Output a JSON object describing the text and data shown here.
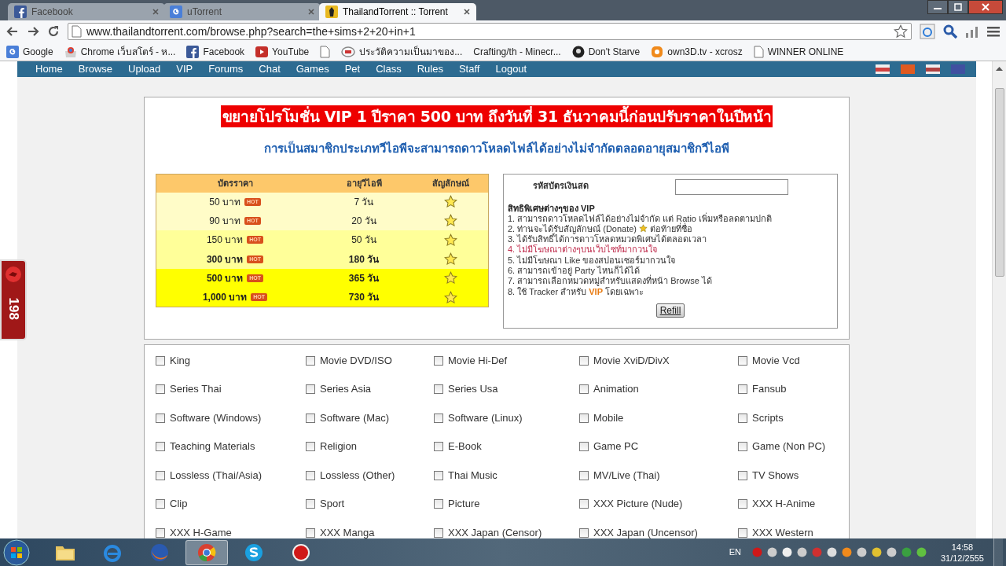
{
  "browser": {
    "tabs": [
      {
        "title": "Facebook",
        "selected": false,
        "kind": "facebook"
      },
      {
        "title": "uTorrent",
        "selected": false,
        "kind": "google"
      },
      {
        "title": "ThailandTorrent :: Torrent",
        "selected": true,
        "kind": "site"
      }
    ],
    "url": "www.thailandtorrent.com/browse.php?search=the+sims+2+20+in+1",
    "bookmarks": [
      {
        "label": "Google",
        "kind": "google"
      },
      {
        "label": "Chrome เว็บสโตร์ - ห...",
        "kind": "store"
      },
      {
        "label": "Facebook",
        "kind": "facebook"
      },
      {
        "label": "YouTube",
        "kind": "youtube"
      },
      {
        "kind": "page"
      },
      {
        "label": "ประวัติความเป็นมาของ...",
        "kind": "ring"
      },
      {
        "label": "Crafting/th - Minecr...",
        "kind": "plain"
      },
      {
        "label": "Don't Starve",
        "kind": "dark"
      },
      {
        "label": "own3D.tv - xcrosz",
        "kind": "orange"
      },
      {
        "label": "WINNER ONLINE",
        "kind": "page"
      }
    ]
  },
  "nav": [
    "Home",
    "Browse",
    "Upload",
    "VIP",
    "Forums",
    "Chat",
    "Games",
    "Pet",
    "Class",
    "Rules",
    "Staff",
    "Logout"
  ],
  "side_badge": "198",
  "promo": {
    "banner": "ขยายโปรโมชั่น VIP 1 ปีราคา 500 บาท ถึงวันที่ 31 ธันวาคมนี้ก่อนปรับราคาในปีหน้า",
    "subtitle": "การเป็นสมาชิกประเภทวีไอพีจะสามารถดาวโหลดไฟล์ได้อย่างไม่จำกัดตลอดอายุสมาชิกวีไอพี",
    "table": {
      "columns": [
        "บัตรราคา",
        "อายุวีไอพี",
        "สัญลักษณ์"
      ],
      "rows": [
        {
          "price": "50 บาท",
          "badge": "HOT",
          "days": "7 วัน",
          "kind": "light",
          "bold": false
        },
        {
          "price": "90 บาท",
          "badge": "HOT",
          "days": "20 วัน",
          "kind": "light",
          "bold": false
        },
        {
          "price": "150 บาท",
          "badge": "HOT",
          "days": "50 วัน",
          "kind": "medium",
          "bold": false
        },
        {
          "price": "300 บาท",
          "badge": "HOT",
          "days": "180 วัน",
          "kind": "medium",
          "bold": true
        },
        {
          "price": "500 บาท",
          "badge": "HOT",
          "days": "365 วัน",
          "kind": "bright",
          "bold": true
        },
        {
          "price": "1,000 บาท",
          "badge": "HOT",
          "days": "730 วัน",
          "kind": "bright",
          "bold": true
        }
      ]
    },
    "card_label": "รหัสบัตรเงินสด",
    "perks_title": "สิทธิพิเศษต่างๆของ VIP",
    "perks": [
      {
        "text": "1. สามารถดาวโหลดไฟล์ได้อย่างไม่จำกัด แต่ Ratio เพิ่มหรือลดตามปกติ",
        "highlight": false
      },
      {
        "text": "2. ท่านจะได้รับสัญลักษณ์ (Donate)",
        "after": "ต่อท้ายที่ชื่อ",
        "highlight": false
      },
      {
        "text": "3. ได้รับสิทธิ์ได้การดาวโหลดหมวดพิเศษได้ตลอดเวลา",
        "highlight": false
      },
      {
        "text": "4. ไม่มีโฆษณาต่างๆบนเว็บไซท์มากวนใจ",
        "highlight": true
      },
      {
        "text": "5. ไม่มีโฆษณา Like ของสปอนเซอร์มากวนใจ",
        "highlight": false
      },
      {
        "text": "6. สามารถเข้าอยู่ Party ไหนก็ได้ได้",
        "highlight": false
      },
      {
        "text": "7. สามารถเลือกหมวดหมู่สำหรับแสดงที่หน้า Browse ได้",
        "highlight": false
      },
      {
        "text": "8. ใช้ Tracker สำหรับ **VIP** โดยเฉพาะ",
        "highlight": false
      }
    ],
    "refill_button": "Refill"
  },
  "categories": [
    {
      "label": "King",
      "checked": false
    },
    {
      "label": "Movie DVD/ISO",
      "checked": false
    },
    {
      "label": "Movie Hi-Def",
      "checked": false
    },
    {
      "label": "Movie XviD/DivX",
      "checked": false
    },
    {
      "label": "Movie Vcd",
      "checked": false
    },
    {
      "label": "Series Thai",
      "checked": false
    },
    {
      "label": "Series Asia",
      "checked": false
    },
    {
      "label": "Series Usa",
      "checked": false
    },
    {
      "label": "Animation",
      "checked": false
    },
    {
      "label": "Fansub",
      "checked": false
    },
    {
      "label": "Software (Windows)",
      "checked": false
    },
    {
      "label": "Software (Mac)",
      "checked": false
    },
    {
      "label": "Software (Linux)",
      "checked": false
    },
    {
      "label": "Mobile",
      "checked": false
    },
    {
      "label": "Scripts",
      "checked": false
    },
    {
      "label": "Teaching Materials",
      "checked": false
    },
    {
      "label": "Religion",
      "checked": false
    },
    {
      "label": "E-Book",
      "checked": false
    },
    {
      "label": "Game PC",
      "checked": false
    },
    {
      "label": "Game (Non PC)",
      "checked": false
    },
    {
      "label": "Lossless (Thai/Asia)",
      "checked": false
    },
    {
      "label": "Lossless (Other)",
      "checked": false
    },
    {
      "label": "Thai Music",
      "checked": false
    },
    {
      "label": "MV/Live (Thai)",
      "checked": false
    },
    {
      "label": "TV Shows",
      "checked": false
    },
    {
      "label": "Clip",
      "checked": false
    },
    {
      "label": "Sport",
      "checked": false
    },
    {
      "label": "Picture",
      "checked": false
    },
    {
      "label": "XXX Picture (Nude)",
      "checked": false
    },
    {
      "label": "XXX H-Anime",
      "checked": false
    },
    {
      "label": "XXX H-Game",
      "checked": false
    },
    {
      "label": "XXX Manga",
      "checked": false
    },
    {
      "label": "XXX Japan (Censor)",
      "checked": false
    },
    {
      "label": "XXX Japan (Uncensor)",
      "checked": false
    },
    {
      "label": "XXX Western",
      "checked": false
    }
  ],
  "taskbar": {
    "apps": [
      {
        "kind": "folder",
        "selected": false
      },
      {
        "kind": "ie",
        "selected": false
      },
      {
        "kind": "firefox",
        "selected": false
      },
      {
        "kind": "chrome",
        "selected": true
      },
      {
        "kind": "skype",
        "selected": false
      },
      {
        "kind": "record",
        "selected": false
      }
    ],
    "language": "EN",
    "time": "14:58",
    "date": "31/12/2555"
  }
}
